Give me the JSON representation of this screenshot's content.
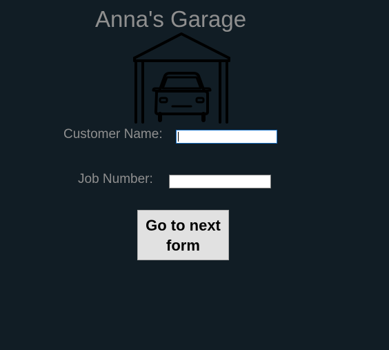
{
  "header": {
    "title": "Anna's Garage",
    "logo_icon": "garage-with-car-icon"
  },
  "form": {
    "customer_name_label": "Customer Name:",
    "customer_name_value": "",
    "job_number_label": "Job Number:",
    "job_number_value": "",
    "next_button_label": "Go to next form"
  },
  "colors": {
    "background": "#111d25",
    "label_text": "#8f8f8f",
    "button_face": "#e1e1e1",
    "focus_border": "#1a73c8"
  }
}
